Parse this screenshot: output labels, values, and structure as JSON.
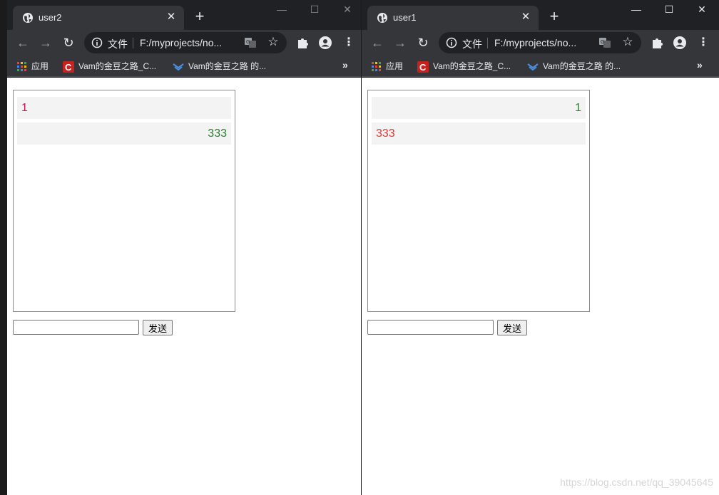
{
  "windows": [
    {
      "tab_title": "user2",
      "address_chip": "文件",
      "url": "F:/myprojects/no...",
      "bookmarks": {
        "apps": "应用",
        "item1": "Vam的金豆之路_C...",
        "item2": "Vam的金豆之路 的..."
      },
      "messages": [
        {
          "text": "1",
          "side": "left",
          "color": "#d4145a"
        },
        {
          "text": "333",
          "side": "right",
          "color": "#2e7d32"
        }
      ],
      "input": {
        "value": "",
        "placeholder": ""
      },
      "send_label": "发送"
    },
    {
      "tab_title": "user1",
      "address_chip": "文件",
      "url": "F:/myprojects/no...",
      "bookmarks": {
        "apps": "应用",
        "item1": "Vam的金豆之路_C...",
        "item2": "Vam的金豆之路 的..."
      },
      "messages": [
        {
          "text": "1",
          "side": "right",
          "color": "#2e7d32"
        },
        {
          "text": "333",
          "side": "left",
          "color": "#e53935"
        }
      ],
      "input": {
        "value": "",
        "placeholder": ""
      },
      "send_label": "发送"
    }
  ],
  "watermark": "https://blog.csdn.net/qq_39045645",
  "icons": {
    "tab": "globe-icon",
    "close": "close-icon",
    "newtab": "plus-icon",
    "back": "back-arrow-icon",
    "forward": "forward-arrow-icon",
    "reload": "reload-icon",
    "info": "info-icon",
    "translate": "translate-icon",
    "star": "star-icon",
    "extensions": "puzzle-icon",
    "profile": "profile-icon",
    "menu": "kebab-menu-icon",
    "apps": "apps-grid-icon",
    "bm1": "csdn-logo-icon",
    "bm2": "chevron-logo-icon",
    "more": "double-chevron-icon"
  },
  "colors": {
    "frame": "#202124",
    "toolbar": "#35363a",
    "page": "#ffffff"
  }
}
